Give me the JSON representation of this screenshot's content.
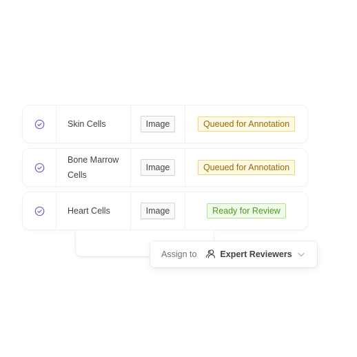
{
  "rows": [
    {
      "name": "Skin Cells",
      "type": "Image",
      "status": "Queued for Annotation",
      "status_kind": "queued",
      "check_icon": "check-circle-icon"
    },
    {
      "name": "Bone Marrow Cells",
      "name_lines": [
        "Bone Marrow",
        "Cells"
      ],
      "type": "Image",
      "status": "Queued for Annotation",
      "status_kind": "queued",
      "check_icon": "check-circle-icon"
    },
    {
      "name": "Heart Cells",
      "type": "Image",
      "status": "Ready for Review",
      "status_kind": "ready",
      "check_icon": "check-circle-icon"
    }
  ],
  "assign": {
    "label": "Assign to",
    "value": "Expert Reviewers",
    "icon": "users-icon",
    "chevron": "chevron-down-icon"
  },
  "colors": {
    "check": "#6b5fc7",
    "queued_text": "#9a6a06",
    "queued_bg": "#fef9e3",
    "ready_text": "#4a9a1f",
    "ready_bg": "#f1fbe9"
  }
}
